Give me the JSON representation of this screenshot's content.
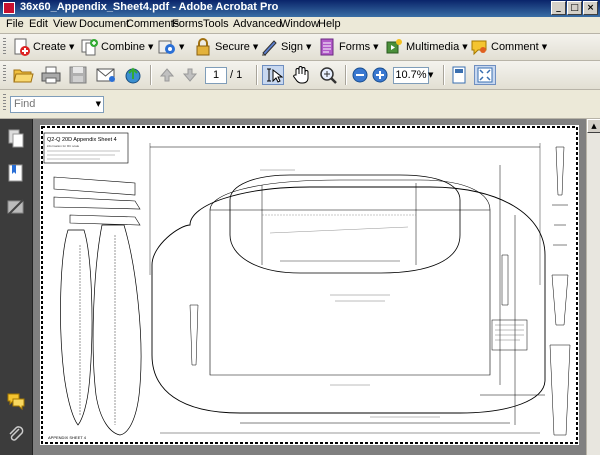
{
  "window": {
    "title": "36x60_Appendix_Sheet4.pdf - Adobe Acrobat Pro",
    "min_glyph": "_",
    "max_glyph": "□",
    "close_glyph": "×"
  },
  "menu": [
    "File",
    "Edit",
    "View",
    "Document",
    "Comments",
    "Forms",
    "Tools",
    "Advanced",
    "Window",
    "Help"
  ],
  "toolbar_tasks": {
    "create": "Create",
    "combine": "Combine",
    "secure": "Secure",
    "sign": "Sign",
    "forms": "Forms",
    "multimedia": "Multimedia",
    "comment": "Comment"
  },
  "navigation": {
    "current_page": "1",
    "page_count": "/ 1",
    "zoom": "10.7%"
  },
  "find": {
    "placeholder": "Find"
  },
  "document": {
    "title": "Q2-Q 20D Appendix Sheet 4",
    "subtitle": "information for RC scale",
    "footer": "APPENDIX SHEET 4"
  },
  "colors": {
    "titlebar": "#0a246a",
    "nav_pane": "#3c3c3c",
    "doc_background": "#808080"
  }
}
